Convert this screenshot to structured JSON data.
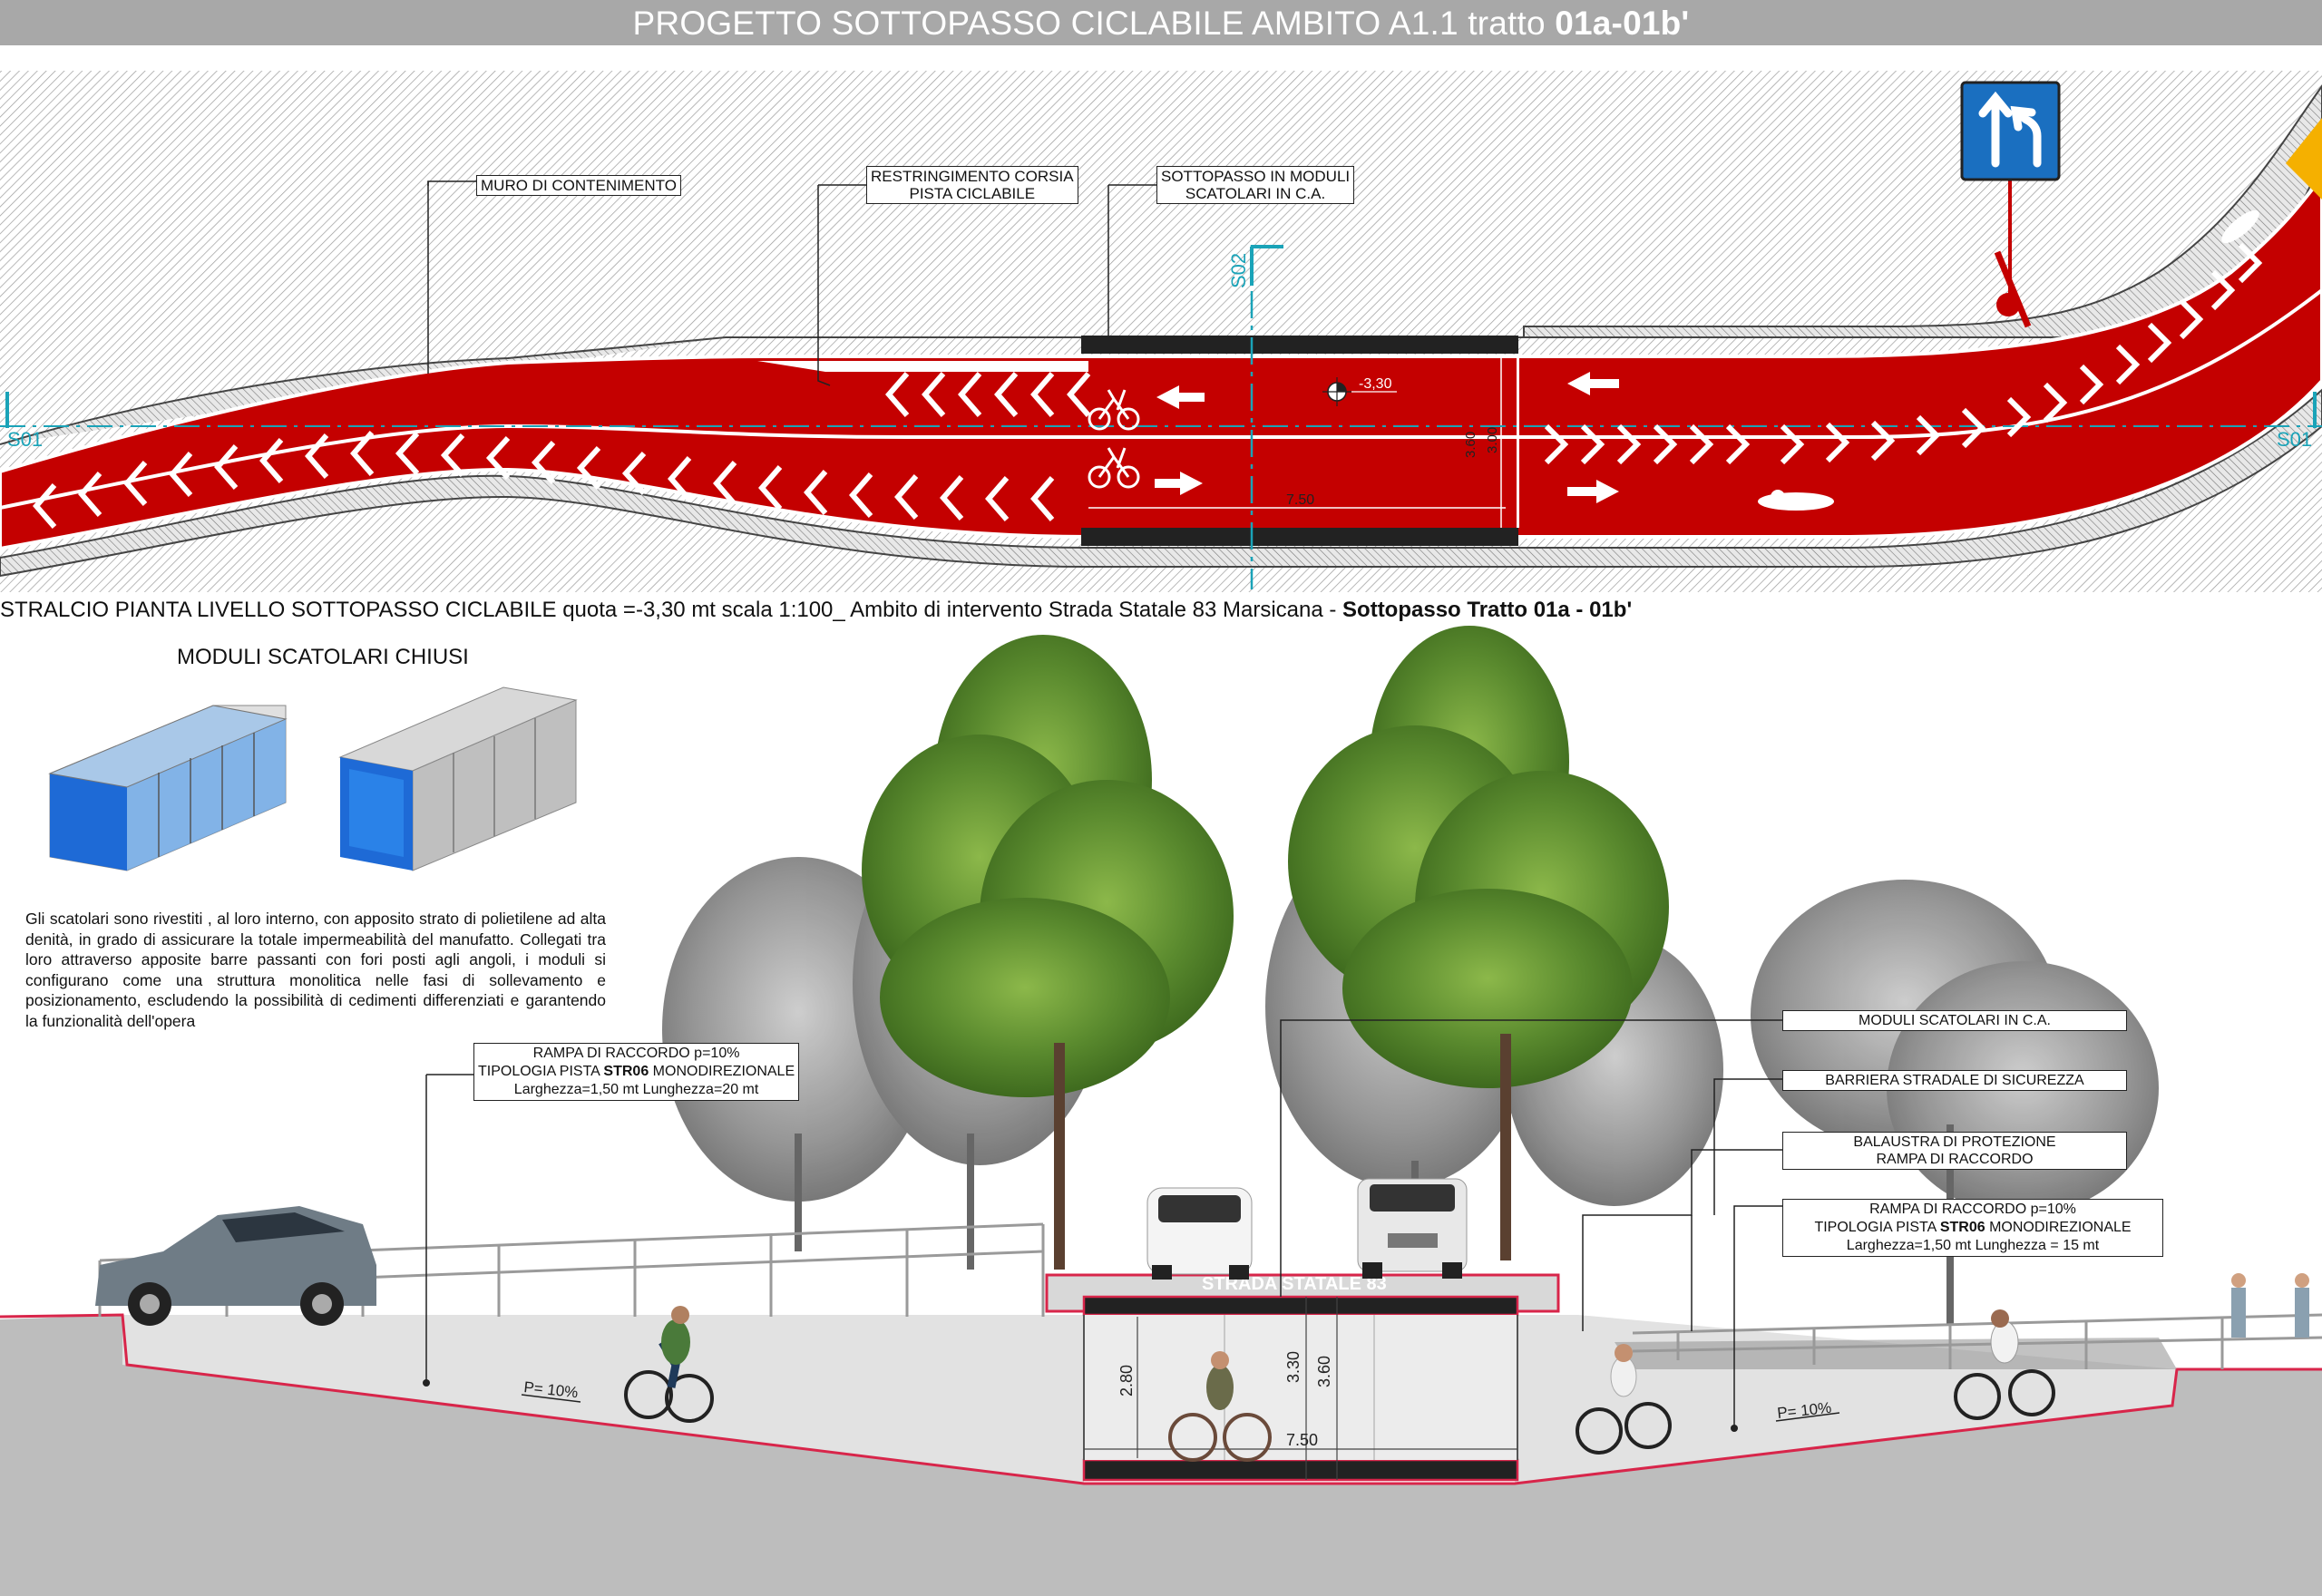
{
  "title": {
    "main": "PROGETTO SOTTOPASSO CICLABILE AMBITO A1.1 tratto ",
    "bold": "01a-01b'"
  },
  "plan": {
    "callouts": {
      "muro": "MURO DI CONTENIMENTO",
      "restringimento_1": "RESTRINGIMENTO CORSIA",
      "restringimento_2": "PISTA CICLABILE",
      "sottopasso_1": "SOTTOPASSO IN MODULI",
      "sottopasso_2": "SCATOLARI IN C.A."
    },
    "section_marks": {
      "s01_left": "S01",
      "s01_right": "S01",
      "s02": "S02"
    },
    "elevation_mark": "-3,30",
    "dims": {
      "width": "7.50",
      "height_a": "3.60",
      "height_b": "3.00"
    }
  },
  "plan_caption": {
    "text": "STRALCIO PIANTA LIVELLO SOTTOPASSO CICLABILE quota =-3,30 mt scala 1:100_ Ambito di intervento Strada Statale 83 Marsicana - ",
    "bold": "Sottopasso Tratto 01a - 01b'"
  },
  "moduli": {
    "title": "MODULI SCATOLARI CHIUSI",
    "description": "Gli scatolari sono rivestiti , al loro interno, con apposito strato di polietilene ad alta denità, in grado di assicurare la totale impermeabilità del manufatto. Collegati tra loro attraverso apposite barre passanti con fori posti agli angoli, i moduli si configurano come una struttura monolitica nelle fasi di sollevamento e posizionamento, escludendo la possibilità di cedimenti differenziati e garantendo la funzionalità dell'opera"
  },
  "section": {
    "left_rampa": {
      "line1": "RAMPA DI RACCORDO p=10%",
      "line2_pre": "TIPOLOGIA PISTA ",
      "line2_bold": "STR06",
      "line2_post": " MONODIREZIONALE",
      "line3": "Larghezza=1,50 mt Lunghezza=20 mt"
    },
    "right_callouts": {
      "moduli": "MODULI SCATOLARI IN C.A.",
      "barriera": "BARRIERA STRADALE DI SICUREZZA",
      "balaustra_1": "BALAUSTRA DI PROTEZIONE",
      "balaustra_2": "RAMPA DI RACCORDO",
      "rampa_1": "RAMPA DI RACCORDO p=10%",
      "rampa_2_pre": "TIPOLOGIA PISTA ",
      "rampa_2_bold": "STR06",
      "rampa_2_post": " MONODIREZIONALE",
      "rampa_3": "Larghezza=1,50 mt Lunghezza = 15 mt"
    },
    "road_label": "STRADA STATALE 83",
    "slope_left": "P= 10%",
    "slope_right": "P= 10%",
    "dims": {
      "h_inner": "2.80",
      "h_mid": "3.30",
      "h_outer": "3.60",
      "width": "7.50"
    }
  },
  "colors": {
    "lane_red": "#c40000",
    "title_bar": "#a8a8a8",
    "sign_blue": "#1a6fc0",
    "section_line": "#d8254a"
  }
}
